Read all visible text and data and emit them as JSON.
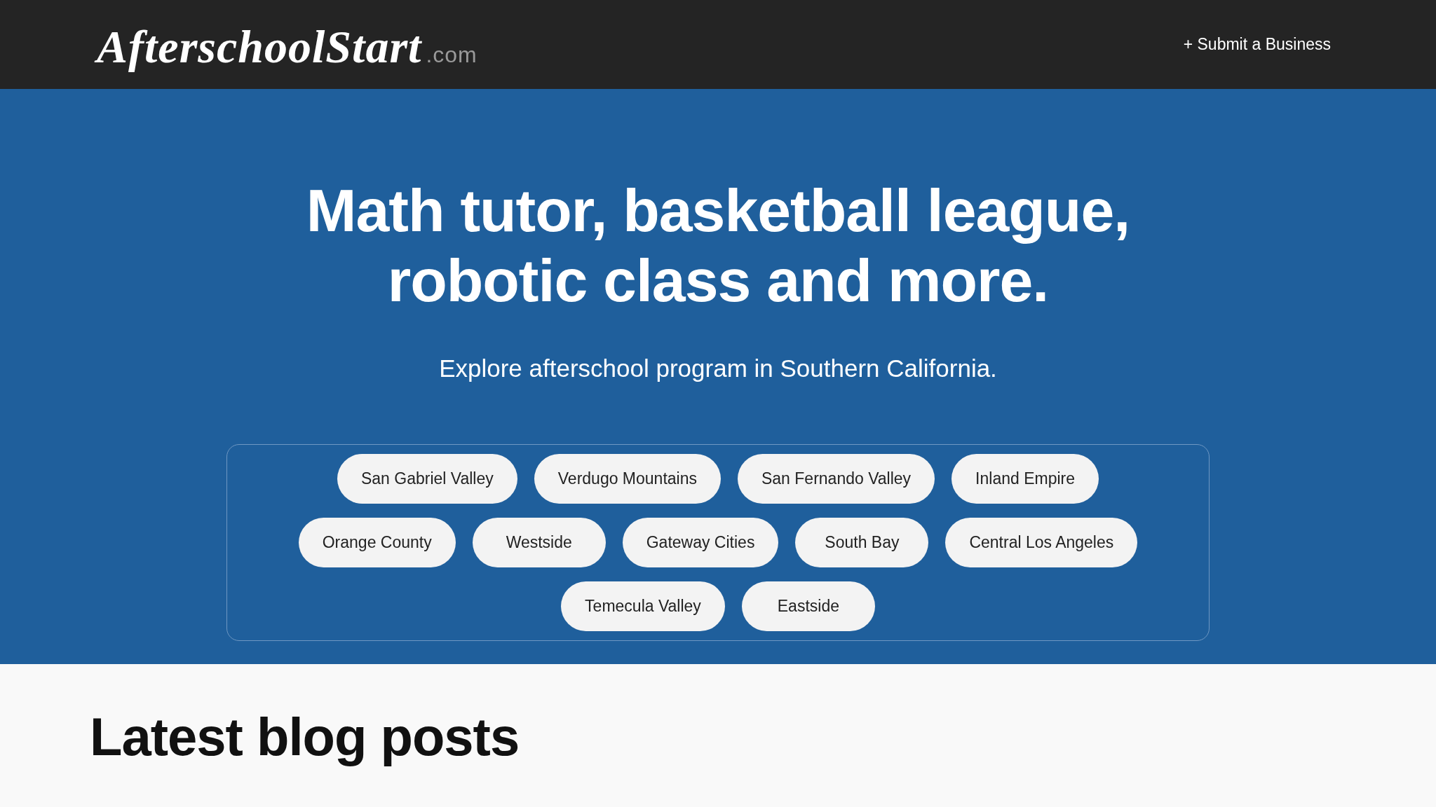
{
  "header": {
    "logo": {
      "name": "AfterschoolStart",
      "suffix": ".com"
    },
    "submit_link": "+ Submit a Business"
  },
  "hero": {
    "title": "Math tutor, basketball league, robotic class and more.",
    "subtitle": "Explore afterschool program in Southern California.",
    "regions": [
      {
        "label": "San Gabriel Valley"
      },
      {
        "label": "Verdugo Mountains"
      },
      {
        "label": "San Fernando Valley"
      },
      {
        "label": "Inland Empire"
      },
      {
        "label": "Orange County"
      },
      {
        "label": "Westside"
      },
      {
        "label": "Gateway Cities"
      },
      {
        "label": "South Bay"
      },
      {
        "label": "Central Los Angeles"
      },
      {
        "label": "Temecula Valley"
      },
      {
        "label": "Eastside"
      }
    ]
  },
  "blog": {
    "heading": "Latest blog posts"
  }
}
